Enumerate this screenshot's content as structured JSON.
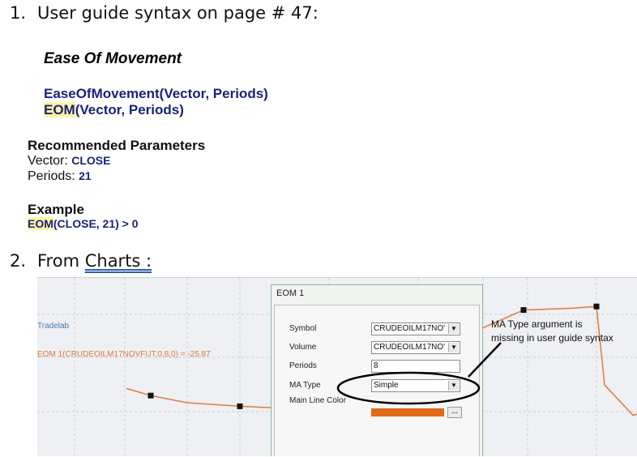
{
  "step1": {
    "number": "1.",
    "text": "User guide syntax on page # 47:"
  },
  "doc": {
    "heading": "Ease Of Movement",
    "syntax_line1": "EaseOfMovement(Vector, Periods)",
    "syntax_line2_hl": "EOM",
    "syntax_line2_rest": "(Vector, Periods)",
    "recommended_heading": "Recommended Parameters",
    "vector_label": "Vector: ",
    "vector_value": "CLOSE",
    "periods_label": "Periods: ",
    "periods_value": "21",
    "example_heading": "Example",
    "example_hl": "EOM",
    "example_rest": "(CLOSE, 21) > 0"
  },
  "step2": {
    "number": "2.",
    "text_prefix": "From ",
    "link_text": "Charts :"
  },
  "chart": {
    "brand_text": "Tradelab",
    "indicator_text": "EOM 1(CRUDEOILM17NOVFUT,0,8,0) = -25.87",
    "line_color": "#e07a3c",
    "series": [
      {
        "x": 0,
        "y": 0.62
      },
      {
        "x": 1,
        "y": 0.66
      },
      {
        "x": 2,
        "y": 0.7
      },
      {
        "x": 3,
        "y": 0.72
      },
      {
        "x": 4,
        "y": 0.73
      },
      {
        "x": 5,
        "y": 0.74
      },
      {
        "x": 6,
        "y": 0.71
      },
      {
        "x": 7,
        "y": 0.28
      },
      {
        "x": 8,
        "y": 0.18
      },
      {
        "x": 9,
        "y": 0.17
      },
      {
        "x": 10,
        "y": 0.16
      },
      {
        "x": 11,
        "y": 0.6
      },
      {
        "x": 12,
        "y": 0.77
      },
      {
        "x": 13,
        "y": 0.76
      }
    ],
    "markers": [
      1,
      3,
      5,
      8,
      10,
      13
    ]
  },
  "dialog": {
    "title": "EOM 1",
    "symbol_label": "Symbol",
    "symbol_value": "CRUDEOILM17NO'",
    "volume_label": "Volume",
    "volume_value": "CRUDEOILM17NO'",
    "periods_label": "Periods",
    "periods_value": "8",
    "ma_type_label": "MA Type",
    "ma_type_value": "Simple",
    "main_line_color_label": "Main Line Color",
    "main_line_color": "#e06a1a",
    "dots_label": "..."
  },
  "callout": {
    "line1": "MA Type argument is",
    "line2": "missing in user guide syntax"
  }
}
